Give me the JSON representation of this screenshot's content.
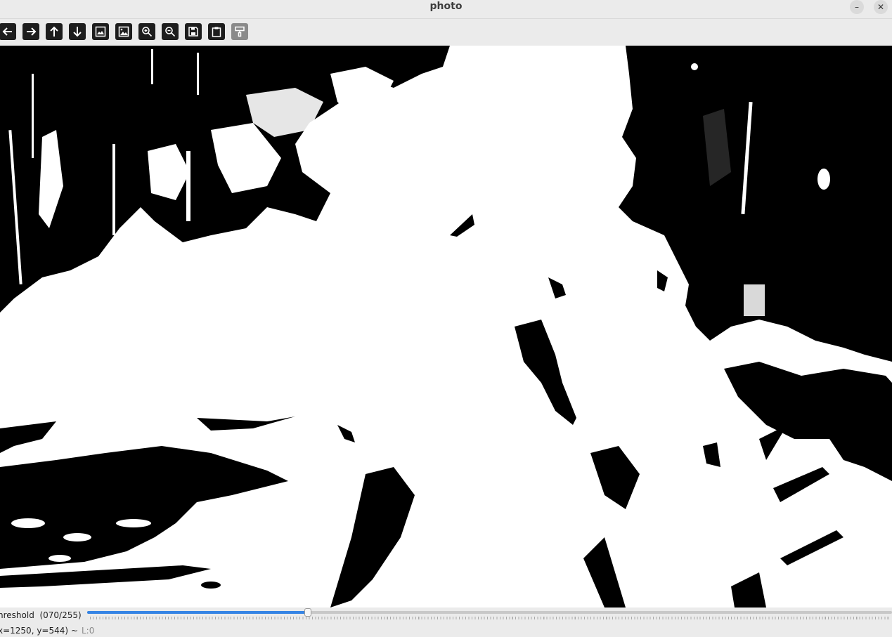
{
  "window": {
    "title": "photo",
    "minimize_label": "–",
    "close_label": "✕"
  },
  "toolbar": {
    "buttons": [
      {
        "name": "pan-left",
        "icon": "arrow-left-icon",
        "enabled": true
      },
      {
        "name": "pan-right",
        "icon": "arrow-right-icon",
        "enabled": true
      },
      {
        "name": "pan-up",
        "icon": "arrow-up-icon",
        "enabled": true
      },
      {
        "name": "pan-down",
        "icon": "arrow-down-icon",
        "enabled": true
      },
      {
        "name": "zoom-fit",
        "icon": "image-icon",
        "enabled": true
      },
      {
        "name": "zoom-original",
        "icon": "image-original-icon",
        "enabled": true
      },
      {
        "name": "zoom-in",
        "icon": "zoom-in-icon",
        "enabled": true
      },
      {
        "name": "zoom-out",
        "icon": "zoom-out-icon",
        "enabled": true
      },
      {
        "name": "save-image",
        "icon": "save-icon",
        "enabled": true
      },
      {
        "name": "copy-to-clipboard",
        "icon": "clipboard-icon",
        "enabled": true
      },
      {
        "name": "properties",
        "icon": "paint-roller-icon",
        "enabled": false
      }
    ]
  },
  "trackbar": {
    "label": "hreshold  (070/255)",
    "value": 70,
    "max": 255,
    "accent": "#3584e4"
  },
  "status": {
    "coords": "x=1250, y=544) ~",
    "level": "L:0"
  }
}
